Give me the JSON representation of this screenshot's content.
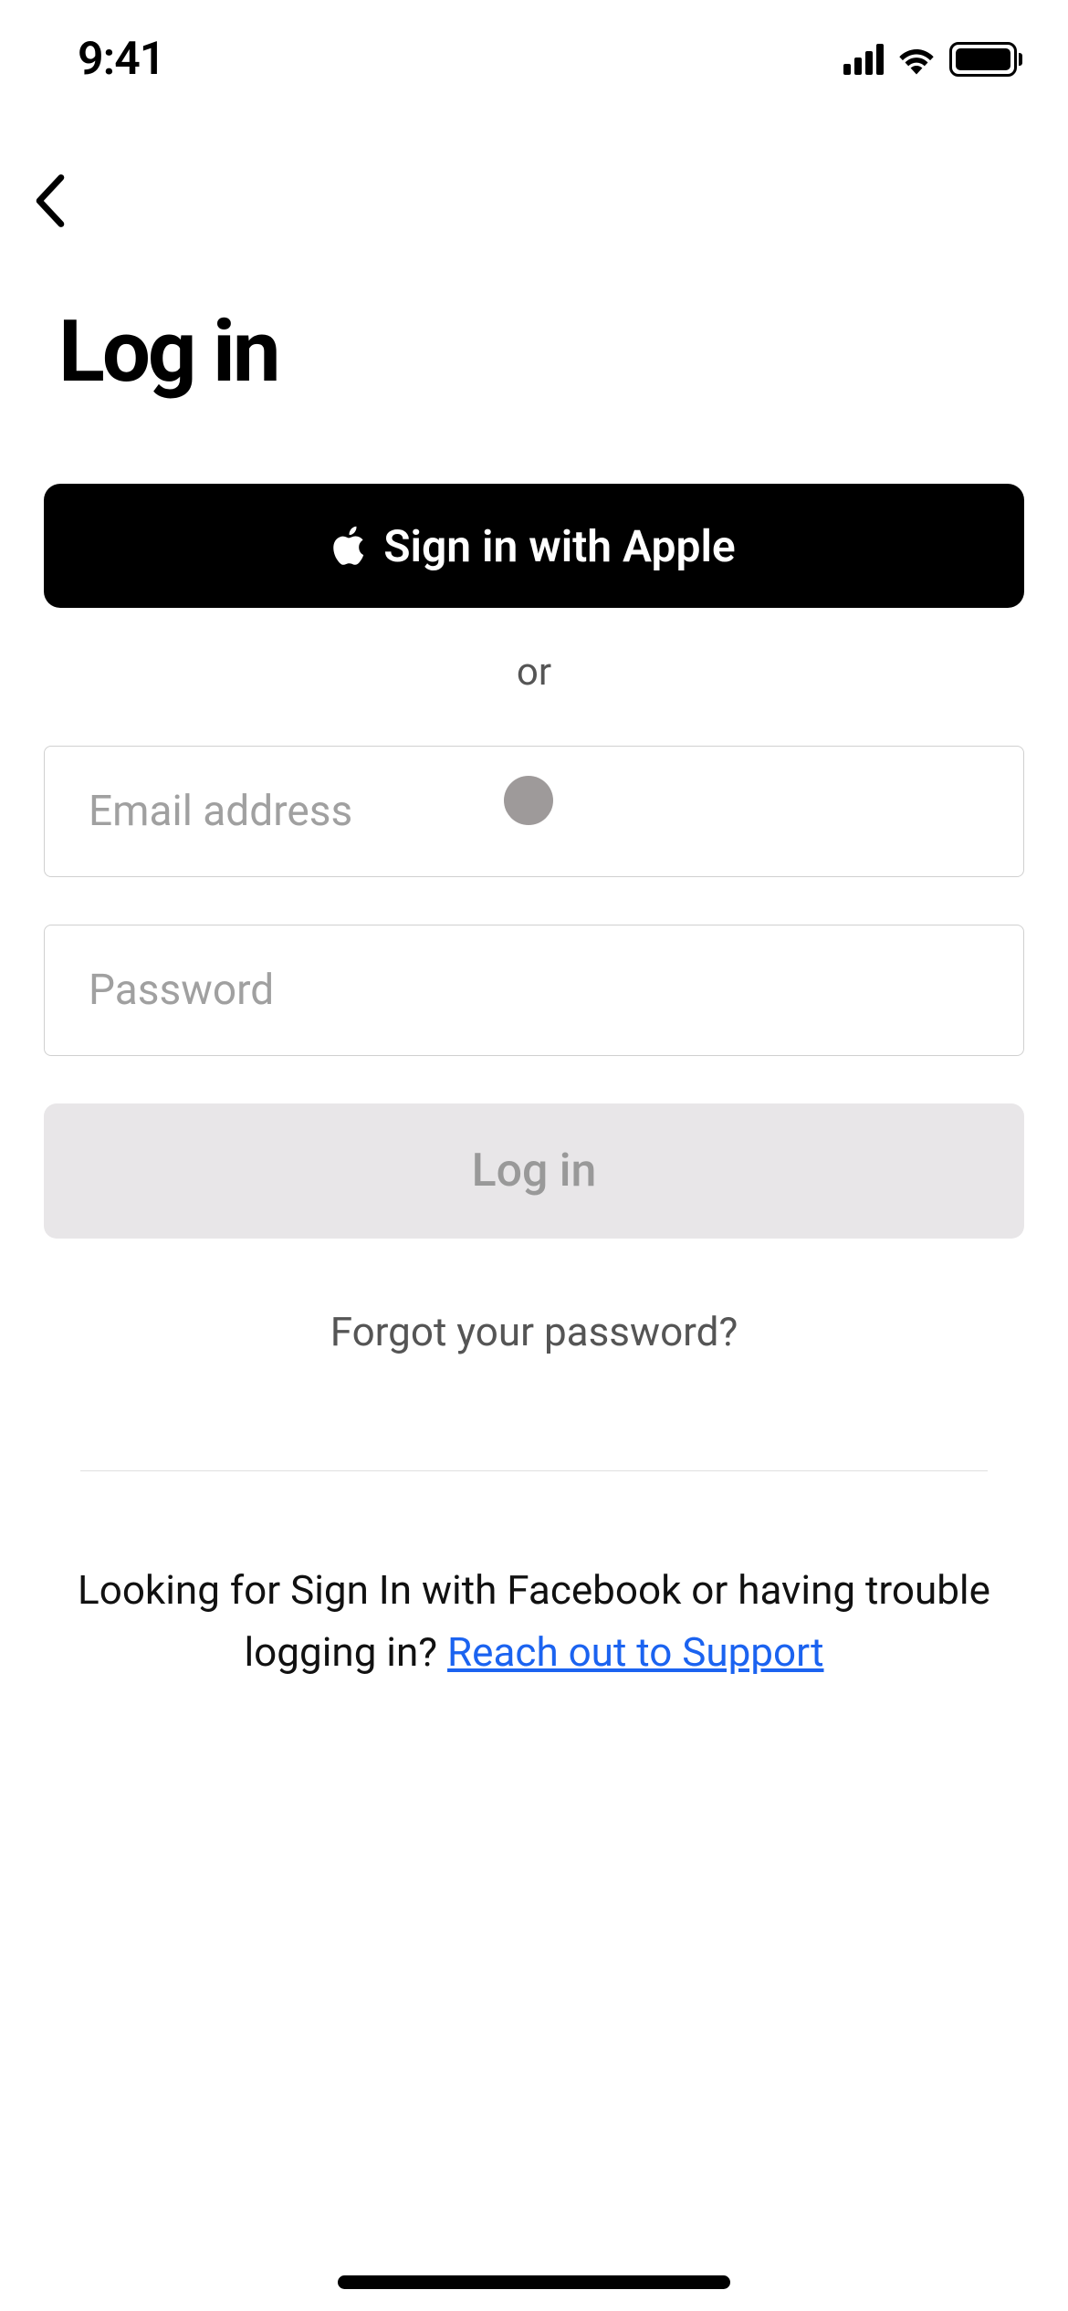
{
  "status": {
    "time": "9:41"
  },
  "page": {
    "title": "Log in"
  },
  "appleButton": {
    "label": "Sign in with Apple"
  },
  "divider": {
    "text": "or"
  },
  "form": {
    "emailPlaceholder": "Email address",
    "passwordPlaceholder": "Password",
    "submitLabel": "Log in"
  },
  "forgot": {
    "label": "Forgot your password?"
  },
  "support": {
    "prefix": "Looking for Sign In with Facebook or having trouble logging in? ",
    "linkText": "Reach out to Support"
  }
}
